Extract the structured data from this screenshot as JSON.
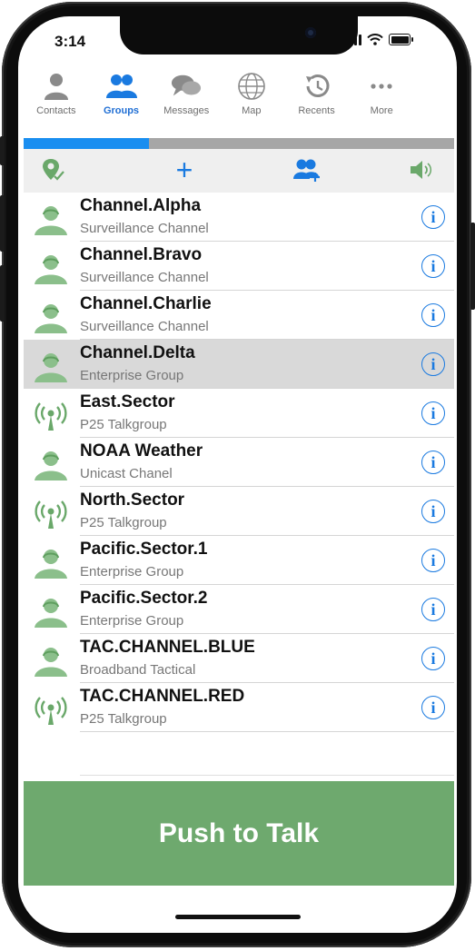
{
  "status": {
    "time": "3:14"
  },
  "tabs": [
    {
      "label": "Contacts",
      "icon": "contact-icon",
      "active": false
    },
    {
      "label": "Groups",
      "icon": "groups-icon",
      "active": true
    },
    {
      "label": "Messages",
      "icon": "messages-icon",
      "active": false
    },
    {
      "label": "Map",
      "icon": "globe-icon",
      "active": false
    },
    {
      "label": "Recents",
      "icon": "history-icon",
      "active": false
    },
    {
      "label": "More",
      "icon": "ellipsis-icon",
      "active": false
    }
  ],
  "toolbar": {
    "location_icon": "location-pin-check-icon",
    "add_icon": "plus-icon",
    "add_symbol": "+",
    "add_member_icon": "add-user-icon",
    "speaker_icon": "speaker-icon"
  },
  "groups": [
    {
      "name": "Channel.Alpha",
      "subtitle": "Surveillance Channel",
      "type": "group",
      "selected": false
    },
    {
      "name": "Channel.Bravo",
      "subtitle": "Surveillance Channel",
      "type": "group",
      "selected": false
    },
    {
      "name": "Channel.Charlie",
      "subtitle": "Surveillance Channel",
      "type": "group",
      "selected": false
    },
    {
      "name": "Channel.Delta",
      "subtitle": "Enterprise Group",
      "type": "group",
      "selected": true
    },
    {
      "name": "East.Sector",
      "subtitle": "P25 Talkgroup",
      "type": "radio",
      "selected": false
    },
    {
      "name": "NOAA Weather",
      "subtitle": "Unicast Chanel",
      "type": "group",
      "selected": false
    },
    {
      "name": "North.Sector",
      "subtitle": "P25 Talkgroup",
      "type": "radio",
      "selected": false
    },
    {
      "name": "Pacific.Sector.1",
      "subtitle": "Enterprise Group",
      "type": "group",
      "selected": false
    },
    {
      "name": "Pacific.Sector.2",
      "subtitle": "Enterprise Group",
      "type": "group",
      "selected": false
    },
    {
      "name": "TAC.CHANNEL.BLUE",
      "subtitle": "Broadband Tactical",
      "type": "group",
      "selected": false
    },
    {
      "name": "TAC.CHANNEL.RED",
      "subtitle": "P25 Talkgroup",
      "type": "radio",
      "selected": false
    }
  ],
  "info_glyph": "i",
  "ptt": {
    "label": "Push to Talk"
  },
  "colors": {
    "accent": "#1a7ae0",
    "tab_active_indicator": "#1a8ef0",
    "group_icon": "#8bbf8b",
    "ptt_background": "#6ea96e",
    "selected_row": "#d9d9d9"
  }
}
